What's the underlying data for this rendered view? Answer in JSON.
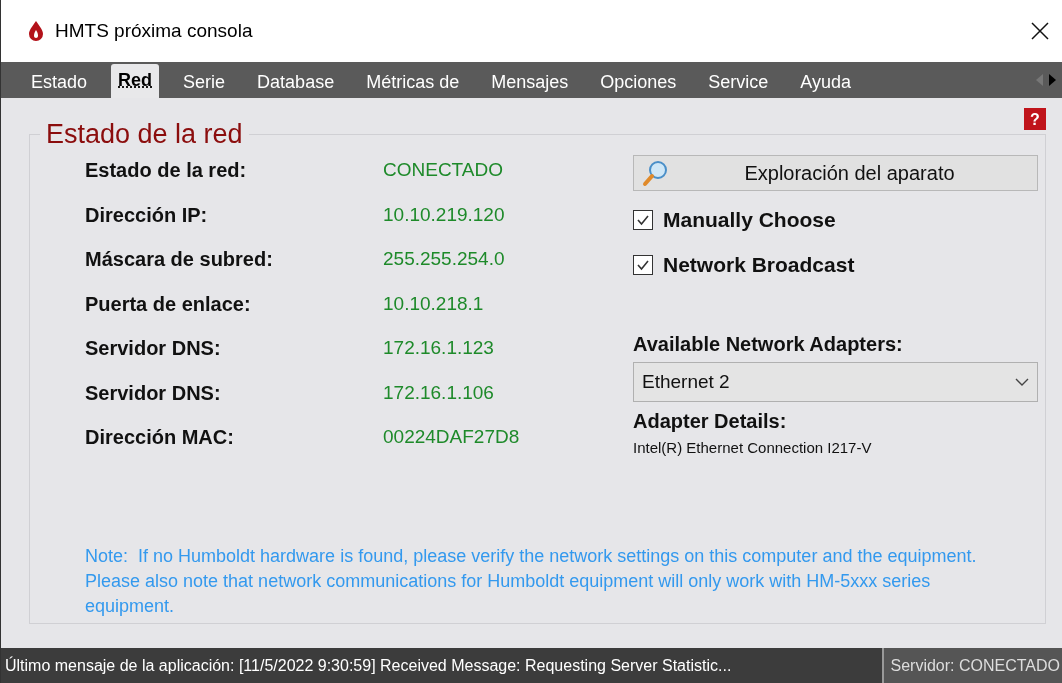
{
  "window": {
    "title": "HMTS próxima consola"
  },
  "tabs": [
    {
      "label": "Estado",
      "selected": false
    },
    {
      "label": "Red",
      "selected": true
    },
    {
      "label": "Serie",
      "selected": false
    },
    {
      "label": "Database",
      "selected": false
    },
    {
      "label": "Métricas de",
      "selected": false
    },
    {
      "label": "Mensajes",
      "selected": false
    },
    {
      "label": "Opciones",
      "selected": false
    },
    {
      "label": "Service",
      "selected": false
    },
    {
      "label": "Ayuda",
      "selected": false
    }
  ],
  "help": "?",
  "group": {
    "title": "Estado de la red",
    "fields": [
      {
        "label": "Estado de la red:",
        "value": "CONECTADO"
      },
      {
        "label": "Dirección IP:",
        "value": "10.10.219.120"
      },
      {
        "label": "Máscara de subred:",
        "value": "255.255.254.0"
      },
      {
        "label": "Puerta de enlace:",
        "value": "10.10.218.1"
      },
      {
        "label": "Servidor DNS:",
        "value": "172.16.1.123"
      },
      {
        "label": "Servidor DNS:",
        "value": "172.16.1.106"
      },
      {
        "label": "Dirección MAC:",
        "value": "00224DAF27D8"
      }
    ],
    "scan_button": "Exploración del aparato",
    "checkboxes": [
      {
        "label": "Manually Choose",
        "checked": true
      },
      {
        "label": "Network Broadcast",
        "checked": true
      }
    ],
    "adapters_label": "Available Network Adapters:",
    "adapter": {
      "value": "Ethernet 2"
    },
    "details_label": "Adapter Details:",
    "details": "Intel(R) Ethernet Connection I217-V",
    "note": "Note:  If no Humboldt hardware is found, please verify the network settings on this computer and the equipment.  Please also note that network communications for Humboldt equipment will only work with HM-5xxx series equipment."
  },
  "status_bar": {
    "message": "Último mensaje de la aplicación:  [11/5/2022 9:30:59] Received Message: Requesting Server Statistic...",
    "server": "Servidor:  CONECTADO"
  }
}
